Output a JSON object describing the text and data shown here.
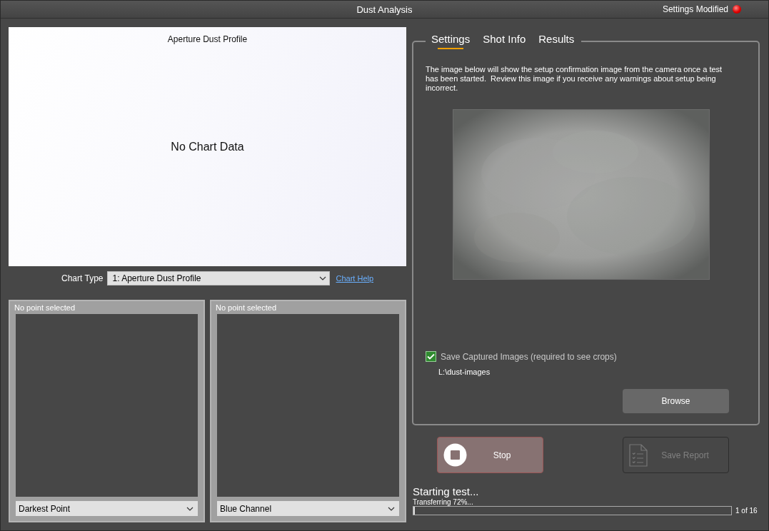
{
  "window": {
    "title": "Dust Analysis",
    "status": "Settings Modified",
    "modified": true
  },
  "chart": {
    "title": "Aperture Dust Profile",
    "message": "No Chart Data"
  },
  "chart_type": {
    "label": "Chart Type",
    "value": "1: Aperture Dust Profile",
    "help_link": "Chart Help"
  },
  "point_panels": [
    {
      "caption": "No point selected",
      "dropdown": "Darkest Point"
    },
    {
      "caption": "No point selected",
      "dropdown": "Blue Channel"
    }
  ],
  "tabs": [
    {
      "label": "Settings",
      "selected": true
    },
    {
      "label": "Shot Info",
      "selected": false
    },
    {
      "label": "Results",
      "selected": false
    }
  ],
  "settings": {
    "description": "The image below will show the setup confirmation image from the camera once a test has been started.  Review this image if you receive any warnings about setup being incorrect.",
    "save_images": {
      "label": "Save Captured Images (required to see crops)",
      "checked": true
    },
    "path": "L:\\dust-images",
    "browse": "Browse"
  },
  "actions": [
    {
      "kind": "stop",
      "label": "Stop",
      "disabled": false
    },
    {
      "kind": "report",
      "label": "Save Report",
      "disabled": true
    }
  ],
  "progress": {
    "status": "Starting test...",
    "detail": "Transferring 72%...",
    "level": 0.005,
    "count": "1 of 16"
  }
}
